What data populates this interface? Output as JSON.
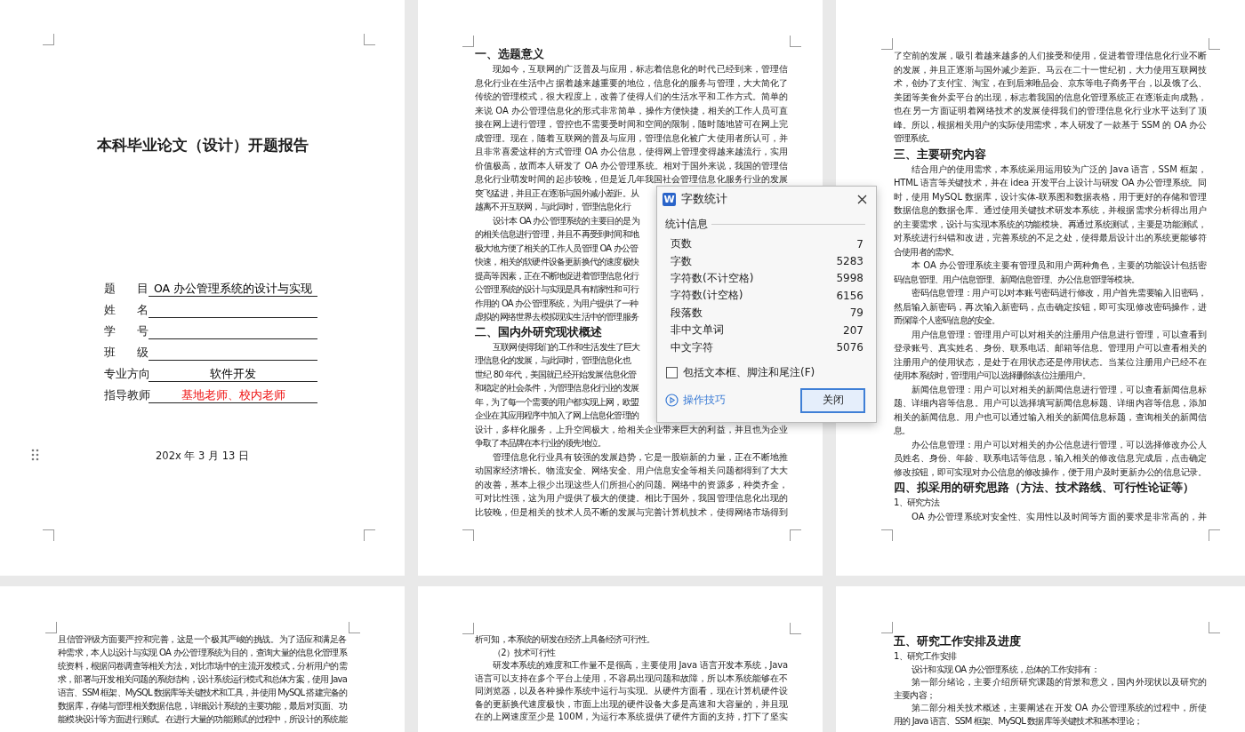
{
  "pages": [
    {
      "kind": "cover",
      "title": "本科毕业论文（设计）开题报告",
      "form": [
        {
          "label": "题 目",
          "value": "OA 办公管理系统的设计与实现",
          "color": "#000000"
        },
        {
          "label": "姓 名"
        },
        {
          "label": "学 号"
        },
        {
          "label": "班 级"
        },
        {
          "label": "专业方向",
          "value": "软件开发",
          "color": "#000000"
        },
        {
          "label": "指导教师",
          "value": "基地老师、校内老师",
          "color": "#ee1111"
        }
      ],
      "date": "202x 年 3 月 13 日"
    },
    {
      "kind": "body",
      "blocks": [
        {
          "kind": "heading",
          "text": "一、选题意义"
        },
        {
          "kind": "paragraph",
          "indent": true,
          "lines": [
            "现如今，互联网的广泛普及与应用，标志着信息化的时代已经到来，管理信",
            "息化行业在生活中占据着越来越重要的地位，信息化的服务与管理，大大简化了",
            "传统的管理模式，很大程度上，改善了使得人们的生活水平和工作方式。简单的",
            "来说 OA 办公管理信息化的形式非常简单，操作方便快捷，相关的工作人员可直",
            "接在网上进行管理，管控也不需要受时间和空间的限制，随时随地皆可在网上完",
            "成管理。现在，随着互联网的普及与应用，管理信息化被广大使用者所认可，并",
            "且非常喜爱这样的方式管理 OA 办公信息，使得网上管理变得越来越流行，实用",
            "价值极高，故而本人研发了 OA 办公管理系统。相对于国外来说，我国的管理信",
            "息化行业萌发时间的起步较晚，但是近几年我国社会管理信息化服务行业的发展",
            "突飞猛进，并且正在逐渐与国外减小差距。从",
            "越离不开互联网，与此同时，管理信息化行"
          ]
        },
        {
          "kind": "paragraph",
          "indent": true,
          "lines": [
            "设计本 OA 办公管理系统的主要目的是为",
            "的相关信息进行管理，并且不再受到时间和地",
            "极大地方便了相关的工作人员管理 OA 办公管",
            "快速，相关的软硬件设备更新换代的速度极快",
            "提高等因素，正在不断地促进着管理信息化行",
            "公管理系统的设计与实现是具有精家性和可行",
            "作用的 OA 办公管理系统，为用户提供了一种",
            "虚拟的网络世界去模拟现实生活中的管理服务"
          ]
        },
        {
          "kind": "heading",
          "text": "二、国内外研究现状概述"
        },
        {
          "kind": "paragraph",
          "indent": true,
          "lines": [
            "互联网使得我们的工作和生活发生了巨大",
            "理信息化的发展，与此同时，管理信息化也",
            "世纪 80 年代，美国就已经开始发展信息化管",
            "和稳定的社会条件，为管理信息化行业的发展",
            "年，为了每一个需要的用户都实现上网，欧盟",
            "企业在其应用程序中加入了网上信息化管理的",
            "设计，多样化服务，上升空间极大，给相关企业带来巨大的利益，并且也为企业",
            "争取了本品牌在本行业的领先地位。"
          ]
        },
        {
          "kind": "paragraph",
          "indent": true,
          "lines": [
            "管理信息化行业具有较强的发展趋势，它是一股崭新的力量，正在不断地推",
            "动国家经济增长。物流安全、网络安全、用户信息安全等相关问题都得到了大大",
            "的改善，基本上很少出现这些人们所担心的问题。网络中的资源多，种类齐全，",
            "可对比性强，这为用户提供了极大的便捷。相比于国外，我国管理信息化出现的",
            "比较晚，但是相关的技术人员不断的发展与完善计算机技术，使得网络市场得到"
          ]
        }
      ]
    },
    {
      "kind": "body",
      "blocks": [
        {
          "kind": "paragraph",
          "indent": false,
          "lines": [
            "了空前的发展，吸引着越来越多的人们接受和使用，促进着管理信息化行业不断",
            "的发展，并且正逐渐与国外减少差距。马云在二十一世纪初，大力使用互联网技",
            "术，创办了支付宝、淘宝，在到后来唯品会、京东等电子商务平台，以及饿了么、",
            "美团等美食外卖平台的出现，标志着我国的信息化管理系统正在逐渐走向成熟，",
            "也在另一方面证明着网络技术的发展使得我们的管理信息化行业水平达到了顶",
            "峰。所以，根据相关用户的实际使用需求，本人研发了一款基于 SSM 的 OA 办公",
            "管理系统。"
          ]
        },
        {
          "kind": "heading",
          "text": "三、主要研究内容"
        },
        {
          "kind": "paragraph",
          "indent": true,
          "lines": [
            "结合用户的使用需求，本系统采用运用较为广泛的 Java 语言，SSM 框架，",
            "HTML 语言等关键技术，并在 idea 开发平台上设计与研发 OA 办公管理系统。同",
            "时，使用 MySQL 数据库，设计实体-联系图和数据表格，用于更好的存储和管理",
            "数据信息的数据仓库。通过使用关键技术研发本系统，并根据需求分析得出用户",
            "的主要需求，设计与实现本系统的功能模块。再通过系统测试，主要是功能测试，",
            "对系统进行纠错和改进，完善系统的不足之处，使得最后设计出的系统更能够符",
            "合使用者的需求。"
          ]
        },
        {
          "kind": "paragraph",
          "indent": true,
          "lines": [
            "本 OA 办公管理系统主要有管理员和用户两种角色，主要的功能设计包括密",
            "码信息管理、用户信息管理、新闻信息管理、办公信息管理等模块。"
          ]
        },
        {
          "kind": "paragraph",
          "indent": true,
          "lines": [
            "密码信息管理：用户可以对本账号密码进行修改，用户首先需要输入旧密码，",
            "然后输入新密码，再次输入新密码，点击确定按钮，即可实现修改密码操作，进",
            "而保障个人密码信息的安全。"
          ]
        },
        {
          "kind": "paragraph",
          "indent": true,
          "lines": [
            "用户信息管理：管理用户可以对相关的注册用户信息进行管理，可以查看到",
            "登录账号、真实姓名、身份、联系电话、邮箱等信息。管理用户可以查看相关的",
            "注册用户的使用状态，是处于在用状态还是停用状态。当某位注册用户已经不在",
            "使用本系统时，管理用户可以选择删除该位注册用户。"
          ]
        },
        {
          "kind": "paragraph",
          "indent": true,
          "lines": [
            "新闻信息管理：用户可以对相关的新闻信息进行管理，可以查看新闻信息标",
            "题、详细内容等信息。用户可以选择填写新闻信息标题、详细内容等信息，添加",
            "相关的新闻信息。用户也可以通过输入相关的新闻信息标题，查询相关的新闻信",
            "息。"
          ]
        },
        {
          "kind": "paragraph",
          "indent": true,
          "lines": [
            "办公信息管理：用户可以对相关的办公信息进行管理，可以选择修改办公人",
            "员姓名、身份、年龄、联系电话等信息，输入相关的修改信息完成后，点击确定",
            "修改按钮，即可实现对办公信息的修改操作，便于用户及时更新办公的信息记录。"
          ]
        },
        {
          "kind": "heading",
          "text": "四、拟采用的研究思路（方法、技术路线、可行性论证等）"
        },
        {
          "kind": "paragraph",
          "indent": false,
          "lines": [
            "1、研究方法"
          ]
        },
        {
          "kind": "paragraph",
          "indent": true,
          "lines": [
            "OA 办公管理系统对安全性、实用性以及时间等方面的要求是非常高的，并"
          ]
        }
      ]
    },
    {
      "kind": "body",
      "blocks": [
        {
          "kind": "paragraph",
          "indent": false,
          "lines": [
            "且信管评级方面要严控和完善，这是一个极其严峻的挑战。为了适应和满足各",
            "种需求，本人以设计与实现 OA 办公管理系统为目的，查询大量的信息化管理系",
            "统资料，根据问卷调查等相关方法，对比市场中的主流开发模式，分析用户的需",
            "求，部署与开发相关问题的系统结构，设计系统运行模式和总体方案，使用 Java",
            "语言、SSM 框架、MySQL 数据库等关键技术和工具，并使用 MySQL 搭建完备的",
            "数据库，存储与管理相关数据信息，详细设计系统的主要功能，最后对页面、功",
            "能模块设计等方面进行测试。在进行大量的功能测试的过程中，所设计的系统能"
          ]
        }
      ]
    },
    {
      "kind": "body",
      "blocks": [
        {
          "kind": "paragraph",
          "indent": false,
          "lines": [
            "析可知，本系统的研发在经济上具备经济可行性。"
          ]
        },
        {
          "kind": "paragraph",
          "indent": true,
          "lines": [
            "（2）技术可行性"
          ]
        },
        {
          "kind": "paragraph",
          "indent": true,
          "lines": [
            "研发本系统的难度和工作量不是很高，主要使用 Java 语言开发本系统，Java",
            "语言可以支持在多个平台上使用，不容易出现问题和故障，所以本系统能够在不",
            "同浏览器，以及各种操作系统中运行与实现。从硬件方面看，现在计算机硬件设",
            "备的更新换代速度极快，市面上出现的硬件设备大多是高速和大容量的，并且现",
            "在的上网速度至少是 100M，为运行本系统提供了硬件方面的支持，打下了坚实"
          ]
        }
      ]
    },
    {
      "kind": "body",
      "blocks": [
        {
          "kind": "heading",
          "text": "五、研究工作安排及进度"
        },
        {
          "kind": "paragraph",
          "indent": false,
          "lines": [
            "1、研究工作安排"
          ]
        },
        {
          "kind": "paragraph",
          "indent": true,
          "lines": [
            "设计和实现 OA 办公管理系统，总体的工作安排有："
          ]
        },
        {
          "kind": "paragraph",
          "indent": true,
          "lines": [
            "第一部分绪论，主要介绍所研究课题的背景和意义，国内外现状以及研究的",
            "主要内容；"
          ]
        },
        {
          "kind": "paragraph",
          "indent": true,
          "lines": [
            "第二部分相关技术概述，主要阐述在开发 OA 办公管理系统的过程中，所使",
            "用的 Java 语言、SSM 框架、MySQL 数据库等关键技术和基本理论；"
          ]
        }
      ]
    }
  ],
  "dialog": {
    "icon_text": "W",
    "title": "字数统计",
    "group": "统计信息",
    "stats": [
      {
        "label": "页数",
        "value": "7"
      },
      {
        "label": "字数",
        "value": "5283"
      },
      {
        "label": "字符数(不计空格)",
        "value": "5998"
      },
      {
        "label": "字符数(计空格)",
        "value": "6156"
      },
      {
        "label": "段落数",
        "value": "79"
      },
      {
        "label": "非中文单词",
        "value": "207"
      },
      {
        "label": "中文字符",
        "value": "5076"
      }
    ],
    "checkbox": {
      "label": "包括文本框、脚注和尾注(F)",
      "checked": false
    },
    "tips_link": "操作技巧",
    "close_button": "关闭"
  }
}
